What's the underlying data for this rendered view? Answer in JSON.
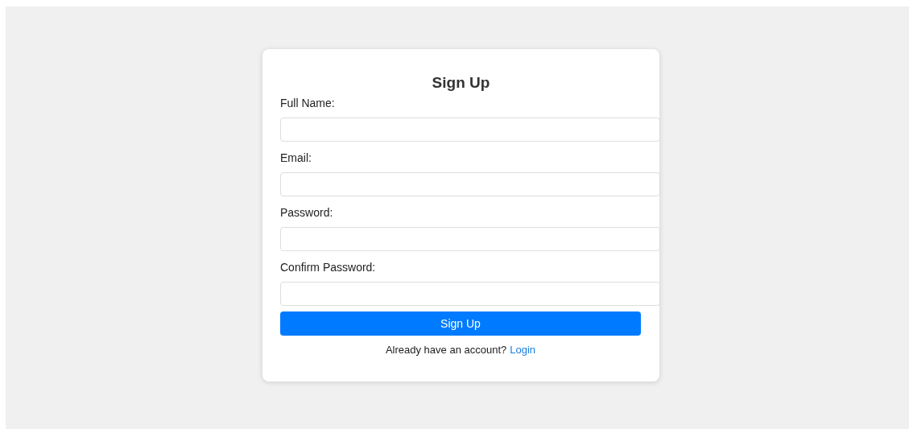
{
  "title": "Sign Up",
  "fields": [
    {
      "label": "Full Name:"
    },
    {
      "label": "Email:"
    },
    {
      "label": "Password:"
    },
    {
      "label": "Confirm Password:"
    }
  ],
  "submit": "Sign Up",
  "footer": {
    "text": "Already have an account?",
    "link": "Login"
  }
}
